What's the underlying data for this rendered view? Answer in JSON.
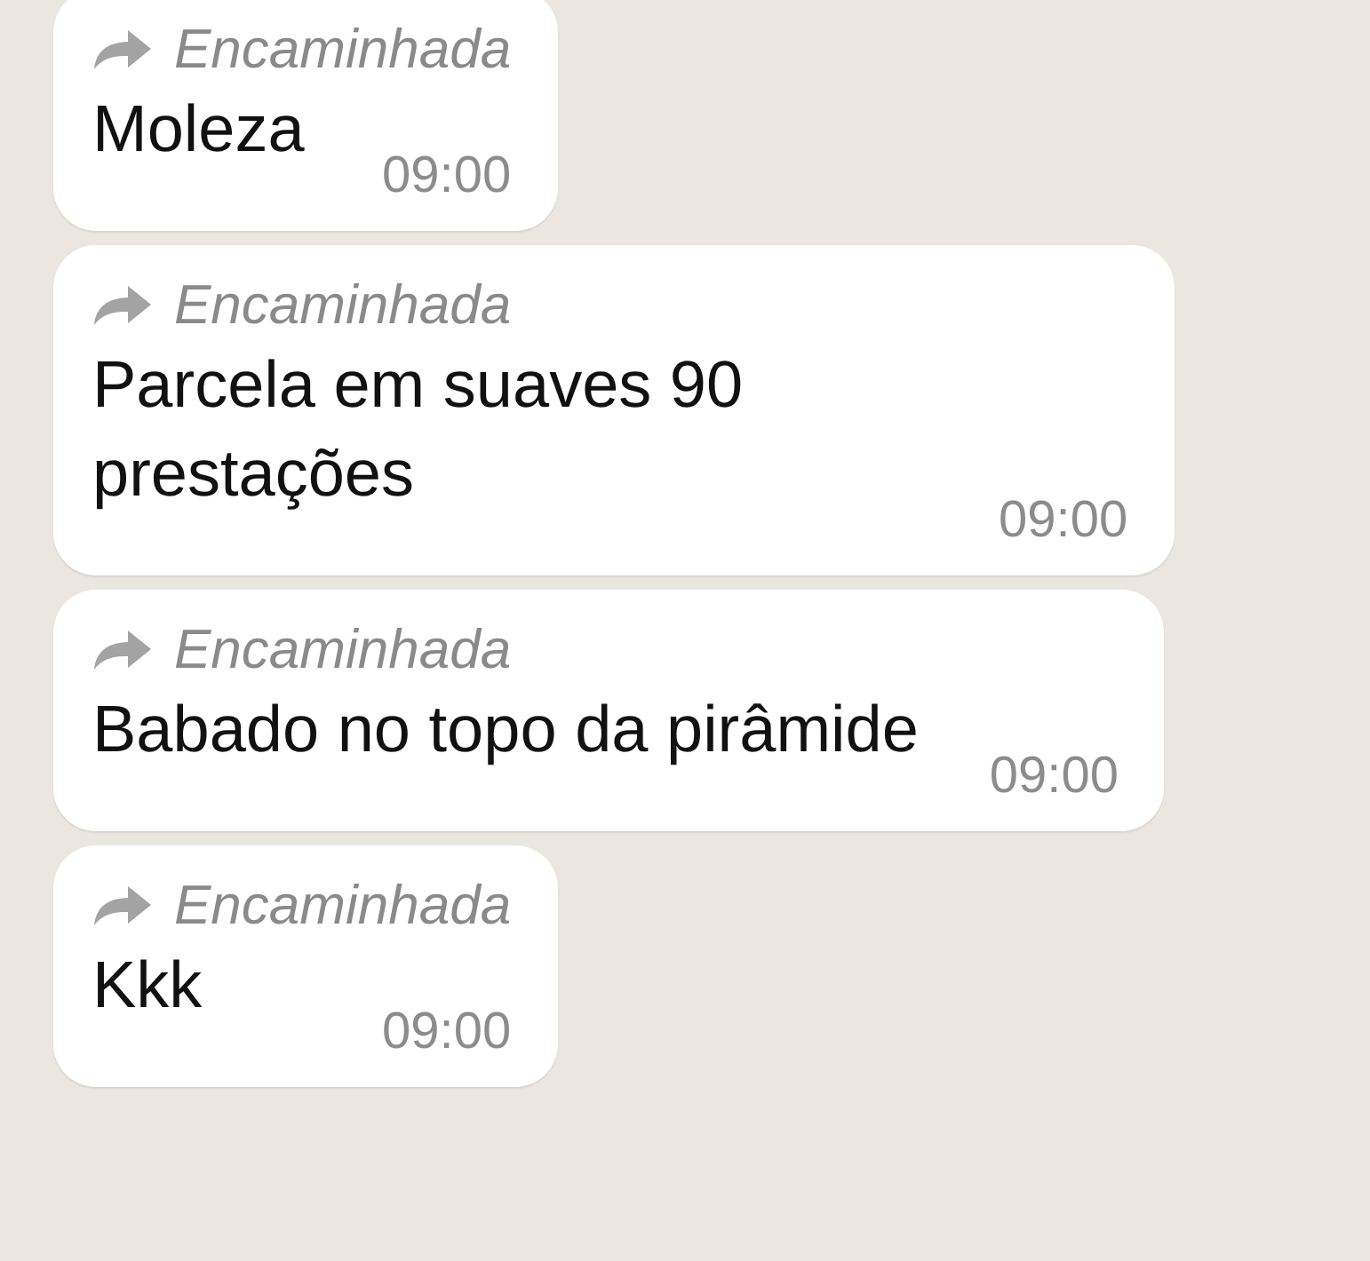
{
  "messages": [
    {
      "forwarded_label": "Encaminhada",
      "text": "Moleza",
      "time": "09:00"
    },
    {
      "forwarded_label": "Encaminhada",
      "text": "Parcela em suaves 90 prestações",
      "time": "09:00"
    },
    {
      "forwarded_label": "Encaminhada",
      "text": "Babado no topo da pirâmide",
      "time": "09:00"
    },
    {
      "forwarded_label": "Encaminhada",
      "text": "Kkk",
      "time": "09:00"
    }
  ]
}
